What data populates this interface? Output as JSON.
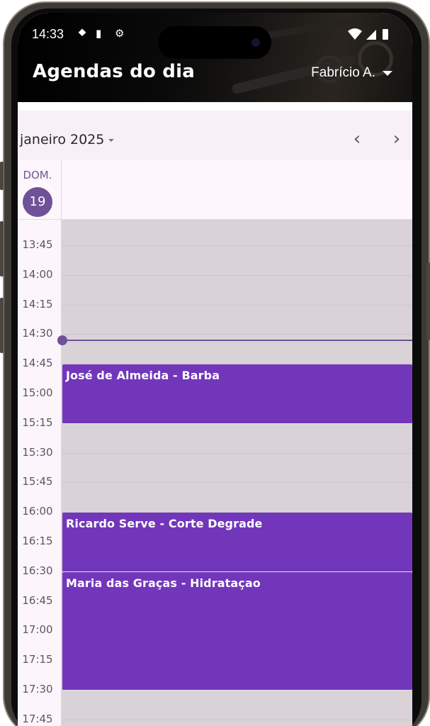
{
  "status_bar": {
    "time": "14:33",
    "icons": [
      "navigation-icon",
      "sd-card-icon",
      "settings-gear-icon"
    ],
    "right_icons": [
      "wifi-icon",
      "signal-icon",
      "battery-icon"
    ]
  },
  "app": {
    "title": "Agendas do dia",
    "user": "Fabrício A."
  },
  "calendar": {
    "month_label": "janeiro 2025",
    "day_of_week": "DOM.",
    "day_number": "19",
    "time_slots": [
      "13:45",
      "14:00",
      "14:15",
      "14:30",
      "14:45",
      "15:00",
      "15:15",
      "15:30",
      "15:45",
      "16:00",
      "16:15",
      "16:30",
      "16:45",
      "17:00",
      "17:15",
      "17:30",
      "17:45"
    ],
    "events": [
      {
        "title": "José de Almeida - Barba",
        "start": "14:45",
        "end": "15:15"
      },
      {
        "title": "Ricardo Serve - Corte Degrade",
        "start": "16:00",
        "end": "16:30"
      },
      {
        "title": "Maria das Graças - Hidrataçao",
        "start": "16:30",
        "end": "17:30"
      }
    ]
  },
  "colors": {
    "accent": "#6e5196",
    "event": "#7236bb",
    "grid_bg": "#d9d3d8"
  }
}
